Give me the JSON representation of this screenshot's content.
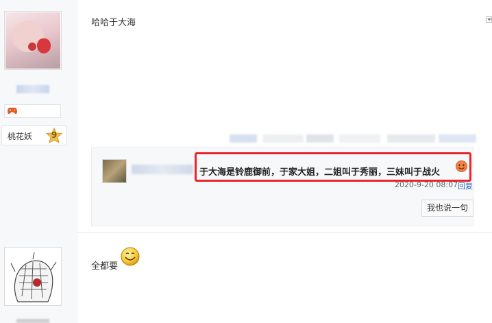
{
  "post1": {
    "text": "哈哈于大海",
    "user": {
      "badge_level_name": "桃花妖",
      "badge_level_num": "9"
    }
  },
  "lzl": {
    "comment_text": "于大海是铃鹿御前，于家大姐，二姐叫于秀丽，三妹叫于战火",
    "time": "2020-9-20 08:07",
    "reply_label": "回复",
    "say_button_label": "我也说一句",
    "emoji": "grinning-face-icon"
  },
  "post2": {
    "text": "全都要",
    "emoji": "smile-face-icon"
  },
  "colors": {
    "highlight": "#e8262a",
    "link": "#2d64b3",
    "badge_gold": "#f2c14e"
  }
}
